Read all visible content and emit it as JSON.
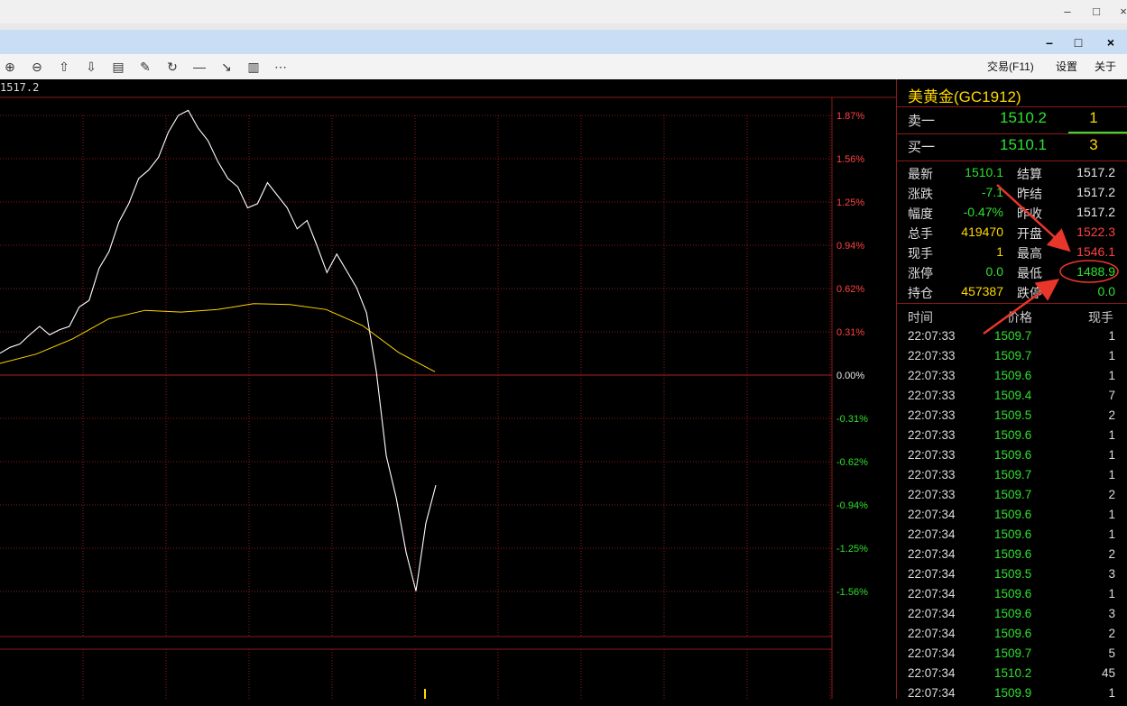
{
  "window": {
    "outer_controls": [
      "–",
      "□",
      "×"
    ],
    "app_controls": [
      "–",
      "□",
      "×"
    ]
  },
  "toolbar": {
    "icons": [
      "zoom-in-icon",
      "zoom-out-icon",
      "arrow-up-icon",
      "arrow-down-icon",
      "layout-icon",
      "draw-icon",
      "refresh-icon",
      "line-icon",
      "arrow-line-icon",
      "color-icon",
      "more-icon"
    ],
    "glyphs": [
      "⊕",
      "⊖",
      "⇧",
      "⇩",
      "▤",
      "✎",
      "↻",
      "—",
      "↘",
      "▥",
      "⋯"
    ],
    "trade_label": "交易(F11)",
    "settings_label": "设置",
    "close_label": "关于"
  },
  "chart": {
    "price_label": "1517.2",
    "pct_labels": [
      "1.87%",
      "1.56%",
      "1.25%",
      "0.94%",
      "0.62%",
      "0.31%",
      "0.00%",
      "-0.31%",
      "-0.62%",
      "-0.94%",
      "-1.25%",
      "-1.56%"
    ]
  },
  "chart_data": {
    "type": "line",
    "title": "",
    "series": [
      {
        "values": [
          1517.2,
          1517.9,
          1518.3,
          1519.4,
          1520.4,
          1519.4,
          1520.0,
          1520.4,
          1522.7,
          1523.5,
          1527.3,
          1529.3,
          1532.8,
          1535.0,
          1538.0,
          1539.0,
          1540.5,
          1543.5,
          1545.5,
          1546.1,
          1544.0,
          1542.5,
          1540.0,
          1538.0,
          1537.0,
          1534.5,
          1535.0,
          1537.5,
          1536.0,
          1534.5,
          1532.0,
          1533.0,
          1530.0,
          1526.8,
          1529.0,
          1527.0,
          1525.0,
          1522.0,
          1515.0,
          1505.0,
          1500.0,
          1493.5,
          1488.9,
          1497.0,
          1501.5
        ]
      },
      {
        "values": [
          1516.0,
          1517.1,
          1518.9,
          1521.3,
          1522.3,
          1522.1,
          1522.4,
          1523.1,
          1523.0,
          1522.4,
          1520.5,
          1517.3,
          1515.0
        ]
      }
    ],
    "ylim": [
      1491.0,
      1545.5
    ],
    "grid": true
  },
  "quote": {
    "symbol": "美黄金(GC1912)",
    "ask_label": "卖一",
    "ask_price": "1510.2",
    "ask_vol": "1",
    "bid_label": "买一",
    "bid_price": "1510.1",
    "bid_vol": "3",
    "left": [
      {
        "label": "最新",
        "value": "1510.1",
        "color": "#2ee02e"
      },
      {
        "label": "涨跌",
        "value": "-7.1",
        "color": "#2ee02e"
      },
      {
        "label": "幅度",
        "value": "-0.47%",
        "color": "#2ee02e"
      },
      {
        "label": "总手",
        "value": "419470",
        "color": "#ffd700"
      },
      {
        "label": "现手",
        "value": "1",
        "color": "#ffd700"
      },
      {
        "label": "涨停",
        "value": "0.0",
        "color": "#2ee02e"
      },
      {
        "label": "持仓",
        "value": "457387",
        "color": "#ffd700"
      }
    ],
    "right": [
      {
        "label": "结算",
        "value": "1517.2",
        "color": "#e8e8e8"
      },
      {
        "label": "昨结",
        "value": "1517.2",
        "color": "#e8e8e8"
      },
      {
        "label": "昨收",
        "value": "1517.2",
        "color": "#e8e8e8"
      },
      {
        "label": "开盘",
        "value": "1522.3",
        "color": "#ff4040"
      },
      {
        "label": "最高",
        "value": "1546.1",
        "color": "#ff4040"
      },
      {
        "label": "最低",
        "value": "1488.9",
        "color": "#2ee02e"
      },
      {
        "label": "跌停",
        "value": "0.0",
        "color": "#2ee02e"
      }
    ]
  },
  "trades": {
    "headers": [
      "时间",
      "价格",
      "现手"
    ],
    "rows": [
      {
        "time": "22:07:33",
        "price": "1509.7",
        "vol": "1"
      },
      {
        "time": "22:07:33",
        "price": "1509.7",
        "vol": "1"
      },
      {
        "time": "22:07:33",
        "price": "1509.6",
        "vol": "1"
      },
      {
        "time": "22:07:33",
        "price": "1509.4",
        "vol": "7"
      },
      {
        "time": "22:07:33",
        "price": "1509.5",
        "vol": "2"
      },
      {
        "time": "22:07:33",
        "price": "1509.6",
        "vol": "1"
      },
      {
        "time": "22:07:33",
        "price": "1509.6",
        "vol": "1"
      },
      {
        "time": "22:07:33",
        "price": "1509.7",
        "vol": "1"
      },
      {
        "time": "22:07:33",
        "price": "1509.7",
        "vol": "2"
      },
      {
        "time": "22:07:34",
        "price": "1509.6",
        "vol": "1"
      },
      {
        "time": "22:07:34",
        "price": "1509.6",
        "vol": "1"
      },
      {
        "time": "22:07:34",
        "price": "1509.6",
        "vol": "2"
      },
      {
        "time": "22:07:34",
        "price": "1509.5",
        "vol": "3"
      },
      {
        "time": "22:07:34",
        "price": "1509.6",
        "vol": "1"
      },
      {
        "time": "22:07:34",
        "price": "1509.6",
        "vol": "3"
      },
      {
        "time": "22:07:34",
        "price": "1509.6",
        "vol": "2"
      },
      {
        "time": "22:07:34",
        "price": "1509.7",
        "vol": "5"
      },
      {
        "time": "22:07:34",
        "price": "1510.2",
        "vol": "45"
      },
      {
        "time": "22:07:34",
        "price": "1509.9",
        "vol": "1"
      }
    ]
  },
  "colors": {
    "grid": "#8b1a1a",
    "up": "#ff4040",
    "down": "#2ee02e",
    "avg": "#ffd700",
    "annotation": "#e8362a"
  }
}
